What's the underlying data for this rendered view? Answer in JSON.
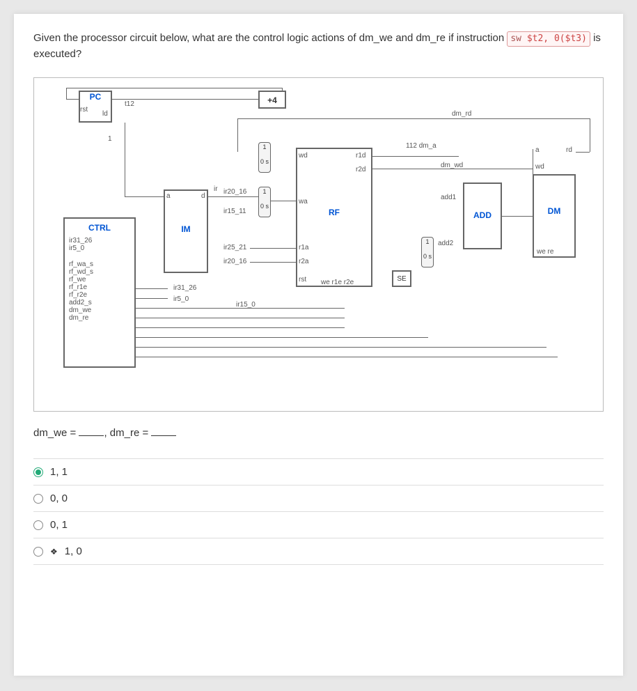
{
  "question": {
    "pre": "Given the processor circuit below, what are the control logic actions of dm_we and dm_re if instruction ",
    "inst_kw": "sw",
    "inst_rest": "$t2, 0($t3)",
    "post": " is executed?"
  },
  "diagram": {
    "pc": "PC",
    "pc_rst": "rst",
    "pc_ld": "ld",
    "pc_tap1": "1",
    "plus4": "+4",
    "tap_t12": "t12",
    "im": {
      "name": "IM",
      "a": "a",
      "d": "d",
      "ir": "ir"
    },
    "ctrl": {
      "name": "CTRL",
      "in1": "ir31_26",
      "in2": "ir5_0",
      "outs": [
        "rf_wa_s",
        "rf_wd_s",
        "rf_we",
        "rf_r1e",
        "rf_r2e",
        "add2_s",
        "dm_we",
        "dm_re"
      ]
    },
    "bits": {
      "ir20_16": "ir20_16",
      "ir15_11": "ir15_11",
      "ir25_21": "ir25_21",
      "ir20_16b": "ir20_16",
      "ir31_26": "ir31_26",
      "ir5_0": "ir5_0",
      "ir15_0": "ir15_0"
    },
    "rf": {
      "name": "RF",
      "wd": "wd",
      "wa": "wa",
      "r1a": "r1a",
      "r2a": "r2a",
      "r1d": "r1d",
      "r2d": "r2d",
      "rst": "rst",
      "ctrl": "we r1e r2e"
    },
    "mux": {
      "one": "1",
      "zero": "0",
      "s": "s",
      "onezero_s": "0 s"
    },
    "se": "SE",
    "add": {
      "name": "ADD",
      "add1": "add1",
      "add2": "add2",
      "dma": "112 dm_a"
    },
    "dm": {
      "name": "DM",
      "a": "a",
      "rd": "rd",
      "wd": "wd",
      "wr": "we re",
      "dm_rd": "dm_rd",
      "dm_wd": "dm_wd"
    }
  },
  "answer": {
    "lhs": "dm_we = ",
    "mid": ", dm_re = "
  },
  "options": [
    {
      "label": "1, 1",
      "selected": true
    },
    {
      "label": "0, 0",
      "selected": false
    },
    {
      "label": "0, 1",
      "selected": false
    },
    {
      "label": "1, 0",
      "selected": false,
      "cursor": true
    }
  ]
}
